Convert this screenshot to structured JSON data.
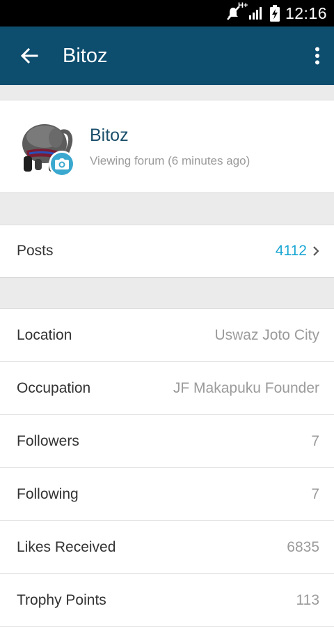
{
  "status_bar": {
    "network_label": "H+",
    "time": "12:16"
  },
  "app_bar": {
    "title": "Bitoz"
  },
  "profile": {
    "name": "Bitoz",
    "status": "Viewing forum (6 minutes ago)"
  },
  "posts": {
    "label": "Posts",
    "count": "4112"
  },
  "details": [
    {
      "label": "Location",
      "value": "Uswaz Joto City"
    },
    {
      "label": "Occupation",
      "value": "JF Makapuku Founder"
    },
    {
      "label": "Followers",
      "value": "7"
    },
    {
      "label": "Following",
      "value": "7"
    },
    {
      "label": "Likes Received",
      "value": "6835"
    },
    {
      "label": "Trophy Points",
      "value": "113"
    }
  ],
  "colors": {
    "app_bar": "#0d4d6e",
    "accent": "#1aa6d3",
    "name": "#1b4f6b"
  }
}
